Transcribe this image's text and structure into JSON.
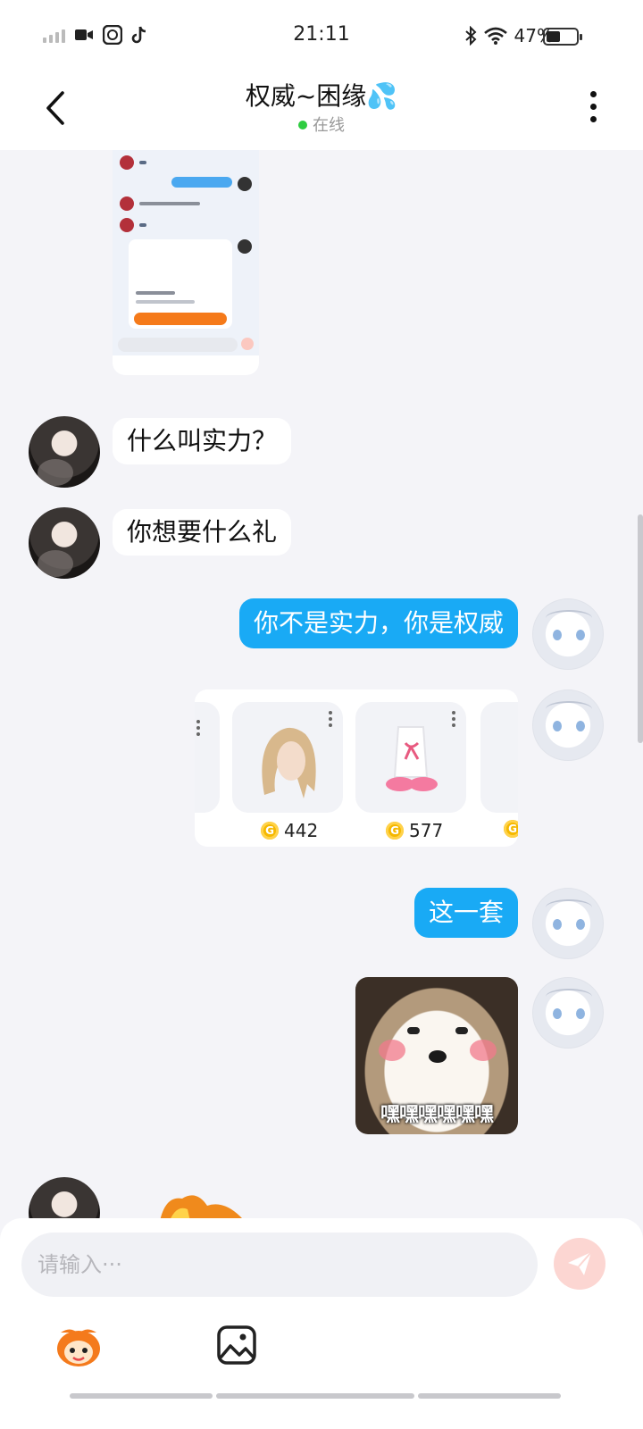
{
  "status_bar": {
    "time": "21:11",
    "battery": "47%",
    "battery_fraction": 0.47,
    "icons": [
      "signal-icon",
      "video-icon",
      "qq-icon",
      "tiktok-icon",
      "bluetooth-icon",
      "wifi-icon",
      "battery-icon"
    ]
  },
  "header": {
    "title": "权威~困缘💦",
    "status": "在线",
    "status_color": "#2ecc40"
  },
  "messages": {
    "m1": "什么叫实力？",
    "m2": "你想要什么礼",
    "m3": "你不是实力，你是权威",
    "m4": "这一套",
    "sticker_caption": "嘿嘿嘿嘿嘿嘿"
  },
  "gift_card": {
    "items": [
      {
        "name": "wig-gift",
        "price": "442"
      },
      {
        "name": "outfit-gift",
        "price": "577"
      }
    ]
  },
  "input": {
    "placeholder": "请输入···"
  },
  "colors": {
    "outgoing_bubble": "#19aaf5",
    "incoming_bubble": "#ffffff",
    "send_button": "#fcd6d2"
  }
}
